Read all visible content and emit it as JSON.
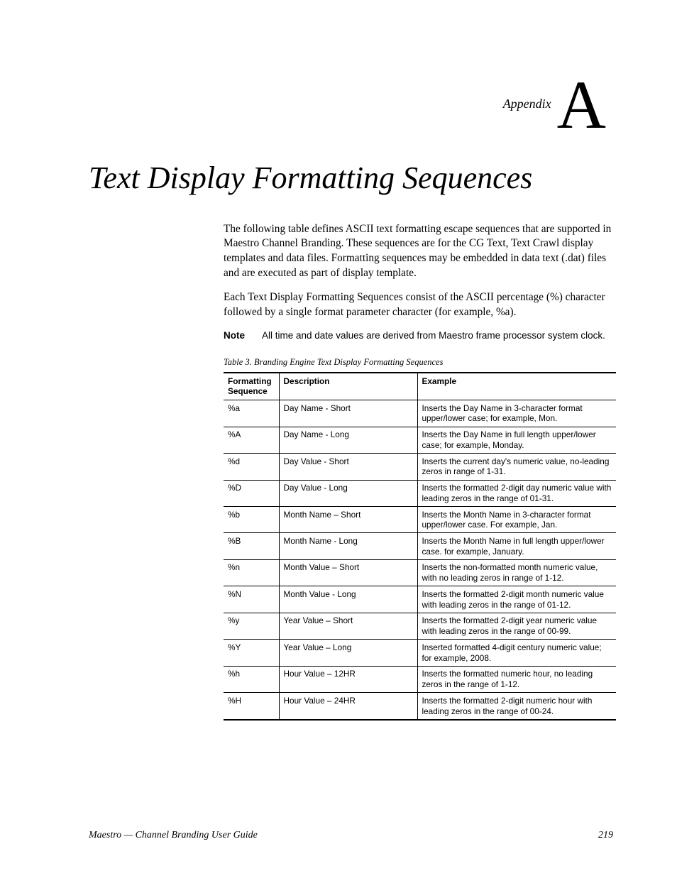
{
  "appendix": {
    "label": "Appendix",
    "letter": "A"
  },
  "title": "Text Display Formatting Sequences",
  "paragraphs": [
    "The following table defines ASCII text formatting escape sequences that are supported in Maestro Channel Branding. These sequences are for the CG Text, Text Crawl display templates and data files. Formatting sequences may be embedded in data text (.dat) files and are executed as part of display template.",
    "Each Text Display Formatting Sequences consist of the ASCII percentage (%) character followed by a single format parameter character (for example, %a)."
  ],
  "note": {
    "label": "Note",
    "text": "All time and date values are derived from Maestro frame processor system clock."
  },
  "table": {
    "caption": "Table 3.  Branding Engine Text Display Formatting Sequences",
    "headers": {
      "seq": "Formatting Sequence",
      "desc": "Description",
      "ex": "Example"
    },
    "rows": [
      {
        "seq": "%a",
        "desc": "Day Name - Short",
        "ex": "Inserts the Day Name in 3-character format upper/lower case; for example, Mon."
      },
      {
        "seq": "%A",
        "desc": "Day Name - Long",
        "ex": "Inserts the Day Name in full length upper/lower case; for example, Monday."
      },
      {
        "seq": "%d",
        "desc": "Day Value - Short",
        "ex": "Inserts the current day's numeric value, no-leading zeros in range of 1-31."
      },
      {
        "seq": "%D",
        "desc": "Day Value - Long",
        "ex": "Inserts the formatted 2-digit day numeric value with leading zeros in the range of 01-31."
      },
      {
        "seq": "%b",
        "desc": "Month Name – Short",
        "ex": "Inserts the Month Name in 3-character format upper/lower case. For example, Jan."
      },
      {
        "seq": "%B",
        "desc": "Month Name - Long",
        "ex": "Inserts the Month Name in full length upper/lower case. for example, January."
      },
      {
        "seq": "%n",
        "desc": "Month Value – Short",
        "ex": "Inserts the non-formatted month numeric value, with no leading zeros in range of 1-12."
      },
      {
        "seq": "%N",
        "desc": "Month Value - Long",
        "ex": "Inserts the formatted 2-digit month numeric value with leading zeros in the range of 01-12."
      },
      {
        "seq": "%y",
        "desc": "Year Value – Short",
        "ex": "Inserts the formatted 2-digit year numeric value with leading zeros in the range of 00-99."
      },
      {
        "seq": "%Y",
        "desc": "Year Value – Long",
        "ex": "Inserted formatted 4-digit century numeric value; for example, 2008."
      },
      {
        "seq": "%h",
        "desc": "Hour Value – 12HR",
        "ex": "Inserts the formatted numeric hour, no leading zeros in the range of 1-12."
      },
      {
        "seq": "%H",
        "desc": "Hour Value – 24HR",
        "ex": "Inserts the formatted 2-digit numeric hour with leading zeros in the range of 00-24."
      }
    ]
  },
  "footer": {
    "left": "Maestro — Channel Branding User Guide",
    "right": "219"
  }
}
